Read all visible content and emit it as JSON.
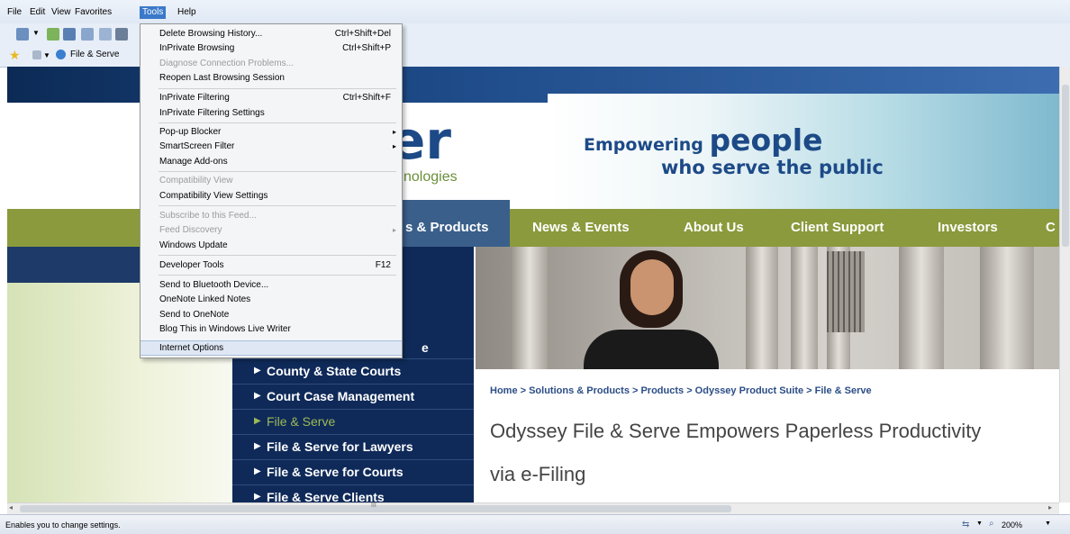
{
  "menubar": {
    "items": [
      "File",
      "Edit",
      "View",
      "Favorites",
      "Tools",
      "Help"
    ],
    "active": "Tools"
  },
  "favorites": {
    "tab_label": "File & Serve"
  },
  "tools_menu": {
    "items": [
      {
        "label": "Delete Browsing History...",
        "shortcut": "Ctrl+Shift+Del"
      },
      {
        "label": "InPrivate Browsing",
        "shortcut": "Ctrl+Shift+P"
      },
      {
        "label": "Diagnose Connection Problems...",
        "disabled": true
      },
      {
        "label": "Reopen Last Browsing Session"
      },
      {
        "label": "InPrivate Filtering",
        "shortcut": "Ctrl+Shift+F"
      },
      {
        "label": "InPrivate Filtering Settings"
      },
      {
        "label": "Pop-up Blocker",
        "submenu": true
      },
      {
        "label": "SmartScreen Filter",
        "submenu": true
      },
      {
        "label": "Manage Add-ons"
      },
      {
        "label": "Compatibility View",
        "disabled": true
      },
      {
        "label": "Compatibility View Settings"
      },
      {
        "label": "Subscribe to this Feed...",
        "disabled": true
      },
      {
        "label": "Feed Discovery",
        "disabled": true,
        "submenu": true
      },
      {
        "label": "Windows Update"
      },
      {
        "label": "Developer Tools",
        "shortcut": "F12"
      },
      {
        "label": "Send to Bluetooth Device..."
      },
      {
        "label": "OneNote Linked Notes"
      },
      {
        "label": "Send to OneNote"
      },
      {
        "label": "Blog This in Windows Live Writer"
      },
      {
        "label": "Internet Options",
        "highlighted": true
      }
    ]
  },
  "site": {
    "logo_partial": "er",
    "logo_sub_partial": "nologies",
    "banner_line1_a": "Empowering ",
    "banner_line1_b": "people",
    "banner_line2": "who serve the public",
    "nav": [
      "s & Products",
      "News & Events",
      "About Us",
      "Client Support",
      "Investors",
      "C"
    ],
    "subnav_partial": "e",
    "subnav": [
      "County & State Courts",
      "Court Case Management",
      "File & Serve",
      "File & Serve for Lawyers",
      "File & Serve for Courts",
      "File & Serve Clients"
    ],
    "subnav_selected": "File & Serve",
    "breadcrumb": "Home > Solutions & Products > Products > Odyssey Product Suite > File & Serve",
    "heading_line1": "Odyssey File & Serve Empowers Paperless Productivity",
    "heading_line2": "via e-Filing"
  },
  "scrollbar": {
    "grip": "III"
  },
  "statusbar": {
    "text": "Enables you to change settings.",
    "zoom": "200%"
  }
}
